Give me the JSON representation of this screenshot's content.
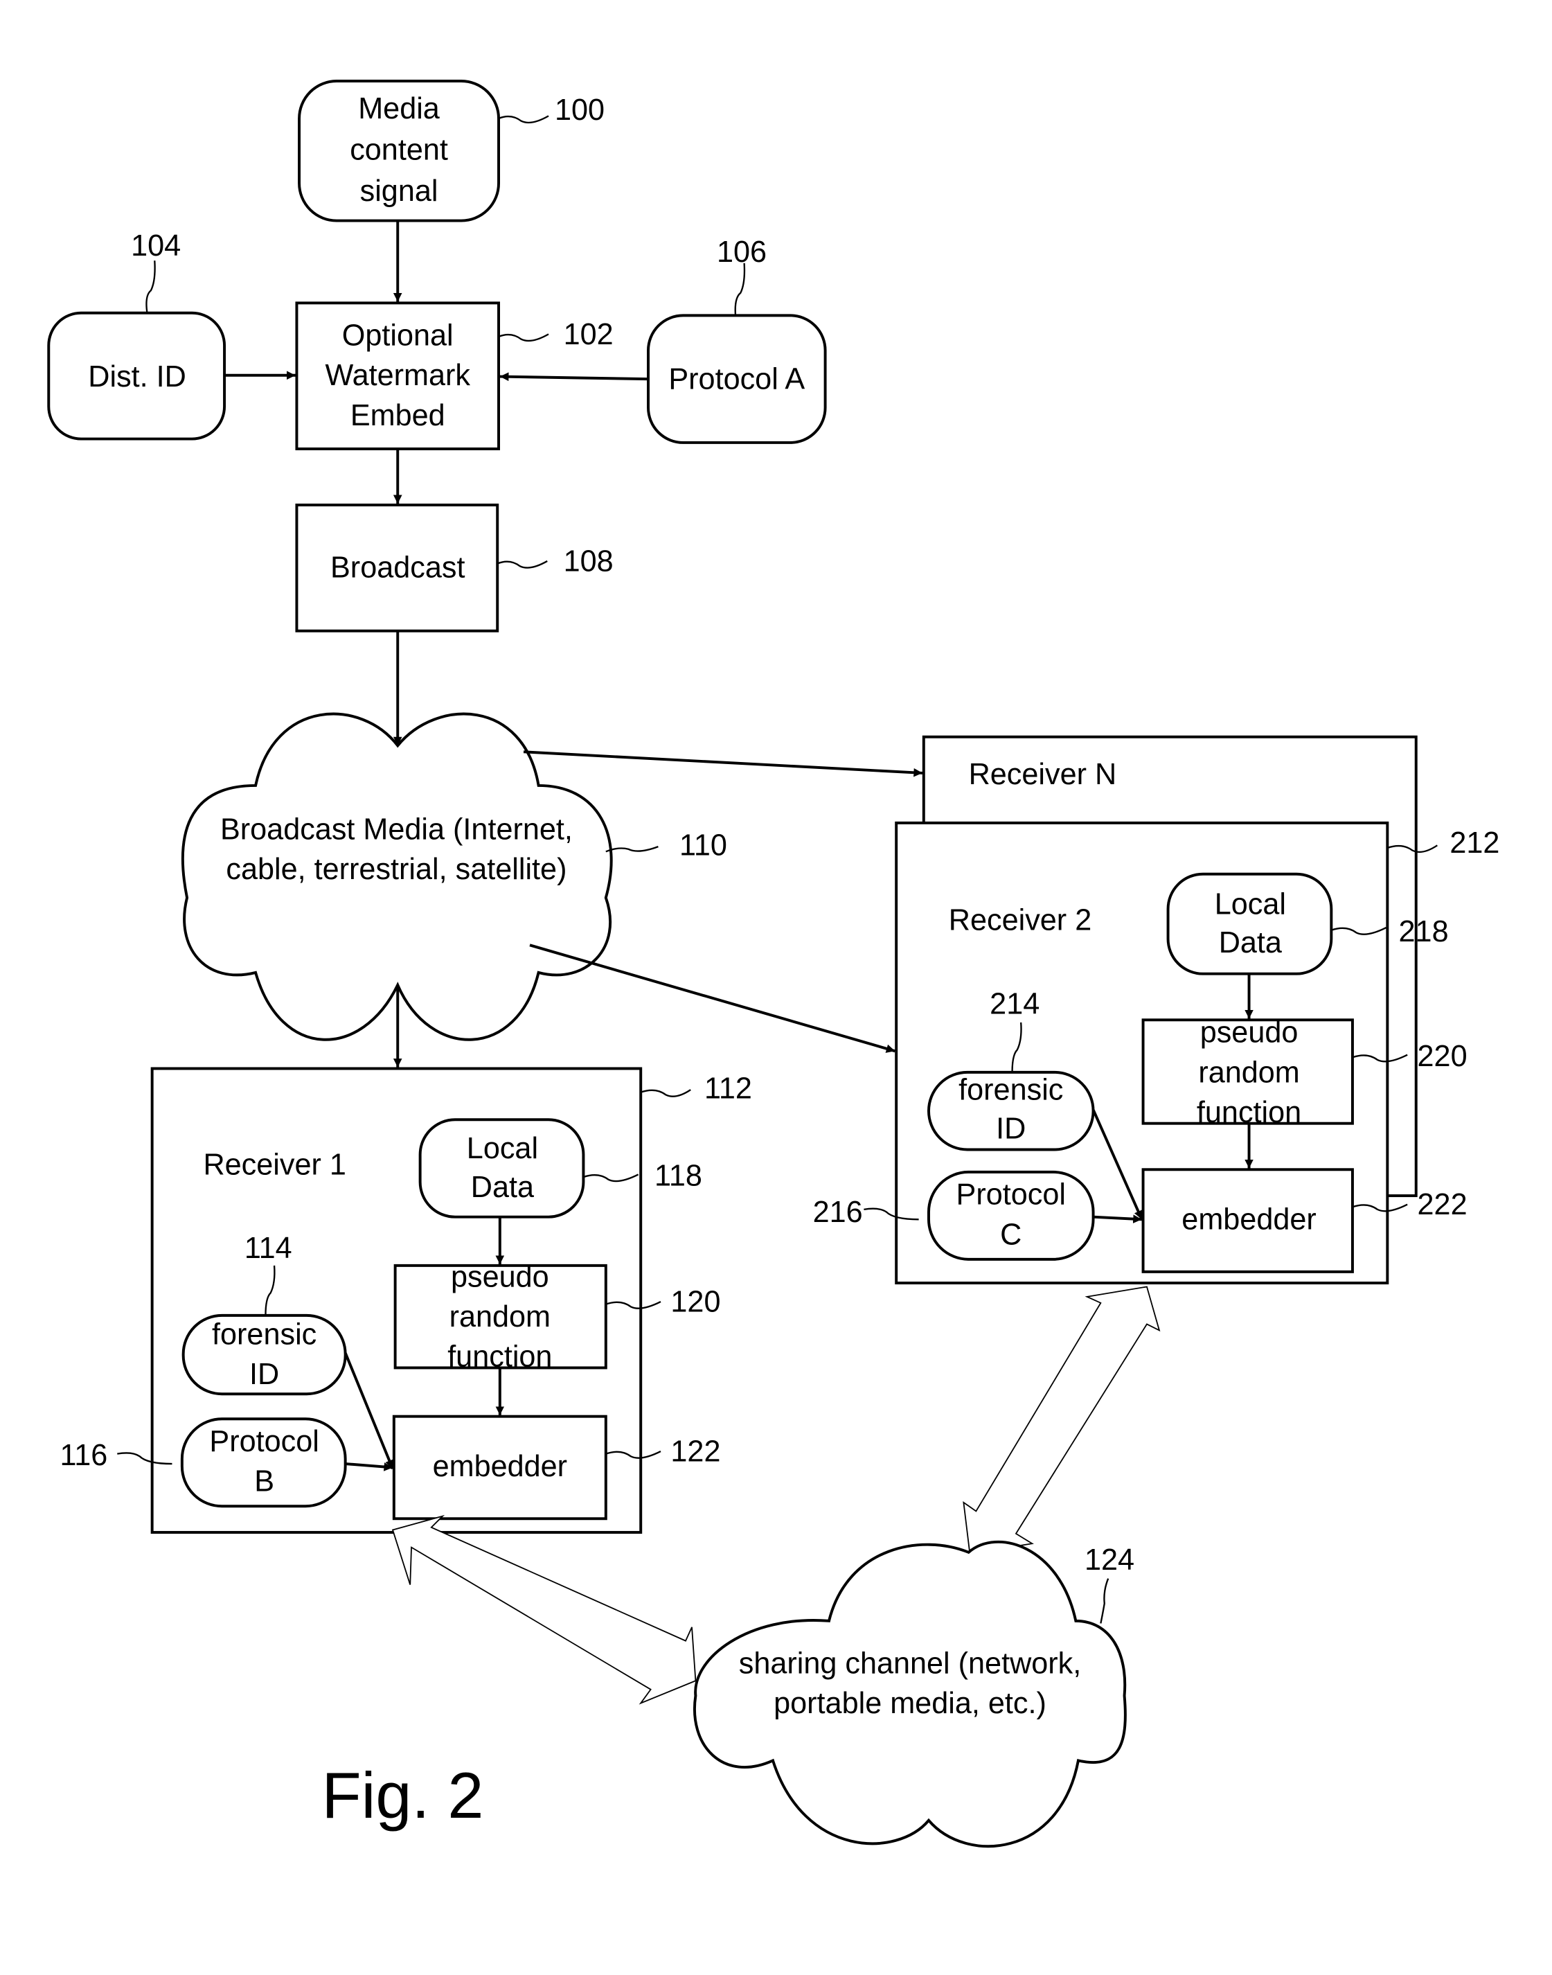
{
  "figure": {
    "caption": "Fig. 2",
    "nodes": {
      "media_content_signal": {
        "lines": [
          "Media",
          "content",
          "signal"
        ],
        "ref": "100"
      },
      "watermark_embed": {
        "lines": [
          "Optional",
          "Watermark",
          "Embed"
        ],
        "ref": "102"
      },
      "dist_id": {
        "lines": [
          "Dist. ID"
        ],
        "ref": "104"
      },
      "protocol_a": {
        "lines": [
          "Protocol A"
        ],
        "ref": "106"
      },
      "broadcast": {
        "lines": [
          "Broadcast"
        ],
        "ref": "108"
      },
      "broadcast_media": {
        "lines": [
          "Broadcast Media (Internet,",
          "cable, terrestrial, satellite)"
        ],
        "ref": "110"
      },
      "receiver_1": {
        "title": "Receiver 1",
        "ref": "112",
        "forensic_id": {
          "lines": [
            "forensic",
            "ID"
          ],
          "ref": "114"
        },
        "protocol": {
          "lines": [
            "Protocol",
            "B"
          ],
          "ref": "116"
        },
        "local_data": {
          "lines": [
            "Local",
            "Data"
          ],
          "ref": "118"
        },
        "prf": {
          "lines": [
            "pseudo",
            "random",
            "function"
          ],
          "ref": "120"
        },
        "embedder": {
          "lines": [
            "embedder"
          ],
          "ref": "122"
        }
      },
      "receiver_n": {
        "title": "Receiver N"
      },
      "receiver_2": {
        "title": "Receiver 2",
        "ref": "212",
        "forensic_id": {
          "lines": [
            "forensic",
            "ID"
          ],
          "ref": "214"
        },
        "protocol": {
          "lines": [
            "Protocol",
            "C"
          ],
          "ref": "216"
        },
        "local_data": {
          "lines": [
            "Local",
            "Data"
          ],
          "ref": "218"
        },
        "prf": {
          "lines": [
            "pseudo",
            "random",
            "function"
          ],
          "ref": "220"
        },
        "embedder": {
          "lines": [
            "embedder"
          ],
          "ref": "222"
        }
      },
      "sharing_channel": {
        "lines": [
          "sharing channel (network,",
          "portable media, etc.)"
        ],
        "ref": "124"
      }
    }
  }
}
